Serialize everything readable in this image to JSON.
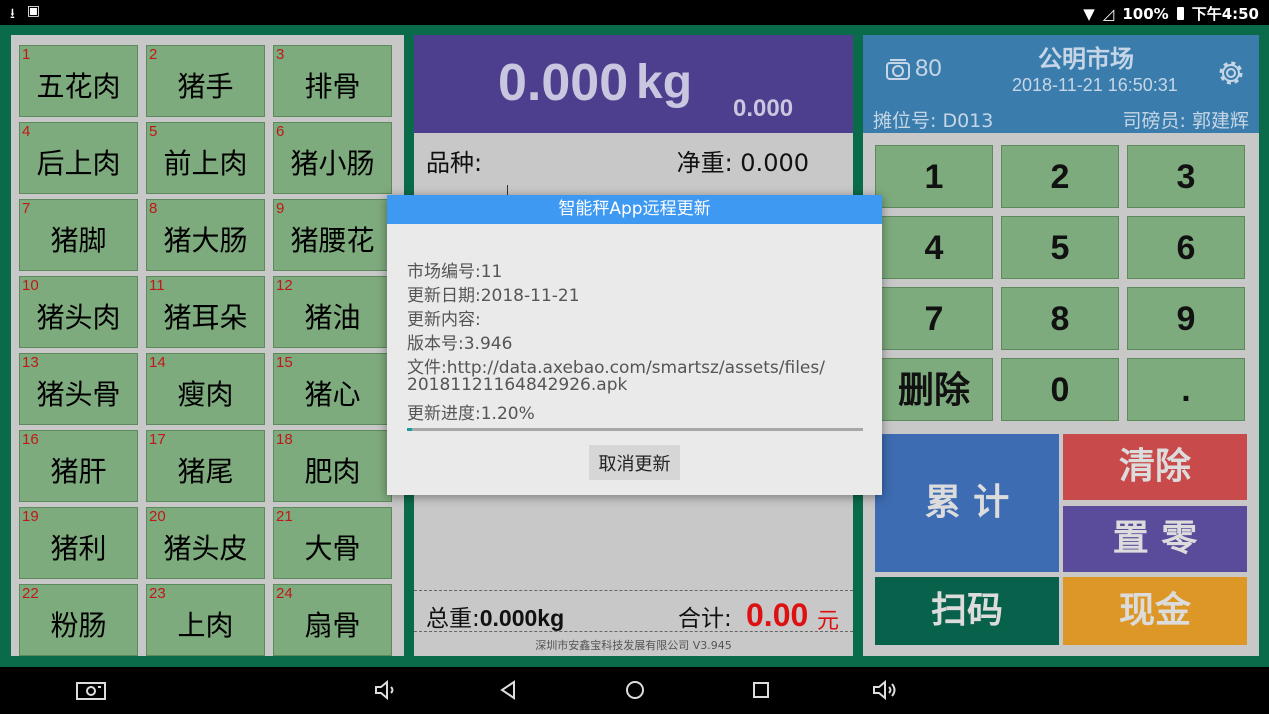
{
  "status_bar": {
    "left_icons": [
      "download-icon",
      "image-icon"
    ],
    "battery": "100%",
    "time": "下午4:50"
  },
  "products": [
    {
      "num": "1",
      "name": "五花肉"
    },
    {
      "num": "2",
      "name": "猪手"
    },
    {
      "num": "3",
      "name": "排骨"
    },
    {
      "num": "4",
      "name": "后上肉"
    },
    {
      "num": "5",
      "name": "前上肉"
    },
    {
      "num": "6",
      "name": "猪小肠"
    },
    {
      "num": "7",
      "name": "猪脚"
    },
    {
      "num": "8",
      "name": "猪大肠"
    },
    {
      "num": "9",
      "name": "猪腰花"
    },
    {
      "num": "10",
      "name": "猪头肉"
    },
    {
      "num": "11",
      "name": "猪耳朵"
    },
    {
      "num": "12",
      "name": "猪油"
    },
    {
      "num": "13",
      "name": "猪头骨"
    },
    {
      "num": "14",
      "name": "瘦肉"
    },
    {
      "num": "15",
      "name": "猪心"
    },
    {
      "num": "16",
      "name": "猪肝"
    },
    {
      "num": "17",
      "name": "猪尾"
    },
    {
      "num": "18",
      "name": "肥肉"
    },
    {
      "num": "19",
      "name": "猪利"
    },
    {
      "num": "20",
      "name": "猪头皮"
    },
    {
      "num": "21",
      "name": "大骨"
    },
    {
      "num": "22",
      "name": "粉肠"
    },
    {
      "num": "23",
      "name": "上肉"
    },
    {
      "num": "24",
      "name": "扇骨"
    }
  ],
  "scale": {
    "weight": "0.000",
    "unit": "kg",
    "sub_weight": "0.000",
    "variety_label": "品种:",
    "net_weight": "净重: 0.000",
    "total_weight_label": "总重:",
    "total_weight_value": "0.000kg",
    "total_label": "合计:",
    "total_value": "0.00",
    "currency": "元",
    "company": "深圳市安鑫宝科技发展有限公司   V3.945"
  },
  "header": {
    "scale_count": "80",
    "market_name": "公明市场",
    "datetime": "2018-11-21  16:50:31",
    "stall": "摊位号: D013",
    "operator": "司磅员: 郭建辉"
  },
  "keypad": [
    "1",
    "2",
    "3",
    "4",
    "5",
    "6",
    "7",
    "8",
    "9",
    "删除",
    "0",
    "."
  ],
  "actions": {
    "accumulate": "累 计",
    "clear": "清除",
    "zero": "置 零",
    "scan": "扫码",
    "cash": "现金"
  },
  "colors": {
    "accumulate": "#3d6cb2",
    "clear": "#c94a4a",
    "zero": "#5b4b9b",
    "scan": "#08614a",
    "cash": "#dc9727"
  },
  "dialog": {
    "title": "智能秤App远程更新",
    "market_no": "市场编号:11",
    "update_date": "更新日期:2018-11-21",
    "content": "更新内容:",
    "version": "版本号:3.946",
    "file_line1": "文件:http://data.axebao.com/smartsz/assets/files/",
    "file_line2": "20181121164842926.apk",
    "progress_text": "更新进度:1.20%",
    "progress": 0.012,
    "cancel": "取消更新"
  },
  "navbar": [
    "screenshot-icon",
    "volume-down-icon",
    "back-icon",
    "home-icon",
    "recents-icon",
    "volume-up-icon"
  ]
}
